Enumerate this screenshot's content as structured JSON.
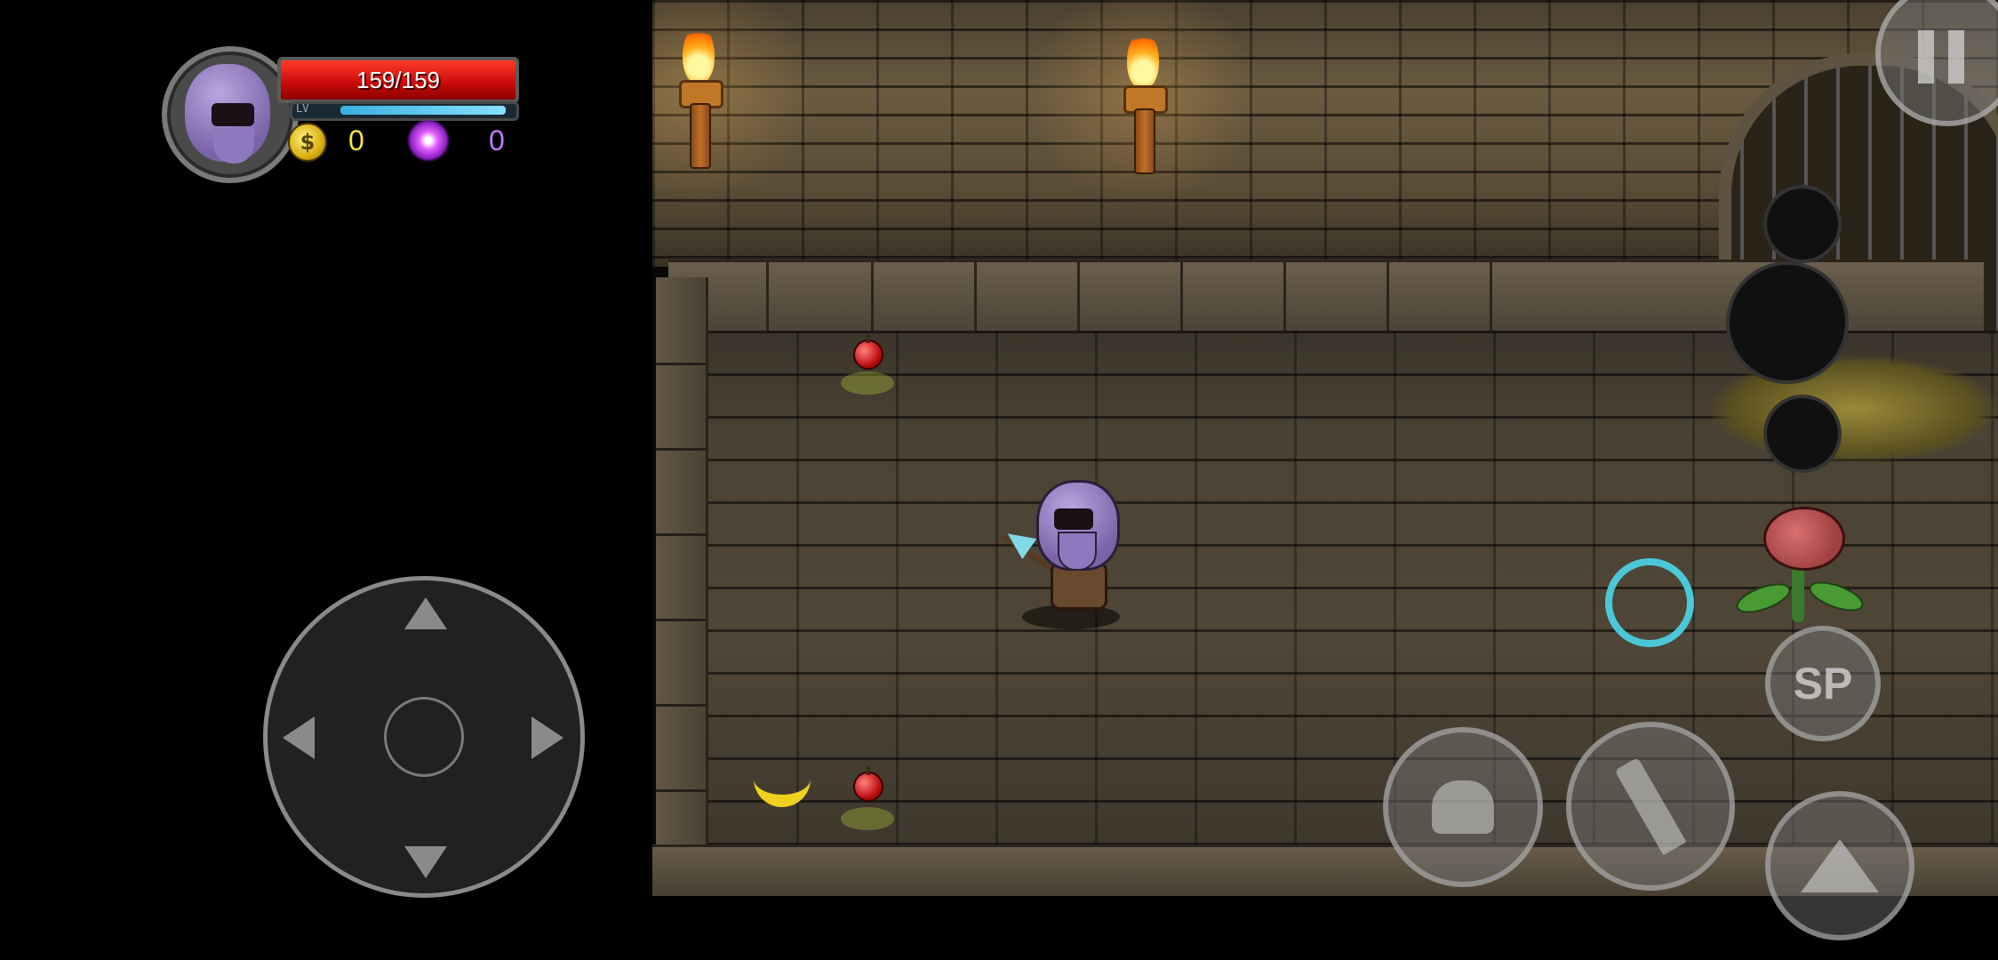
{
  "hud": {
    "hp_text": "159/159",
    "hp_fraction": 1.0,
    "xp_label": "LV",
    "xp_fraction": 0.96,
    "gold_value": "0",
    "soul_value": "0",
    "gold_icon_glyph": "$"
  },
  "controls": {
    "special_label": "SP"
  },
  "icons": {
    "avatar": "hero-portrait-icon",
    "gold": "gold-coin-icon",
    "soul": "soul-swirl-icon",
    "pause": "pause-icon",
    "dash": "dash-icon",
    "attack": "sword-icon",
    "skill": "fist-icon",
    "jump": "jump-arrow-icon",
    "special": "special-sp-icon"
  },
  "colors": {
    "hp": "#c80a0a",
    "xp": "#3ab0e0",
    "gold_text": "#f6e23a",
    "soul_text": "#c07aff",
    "dash_cooldown": "#4ac8d8"
  }
}
